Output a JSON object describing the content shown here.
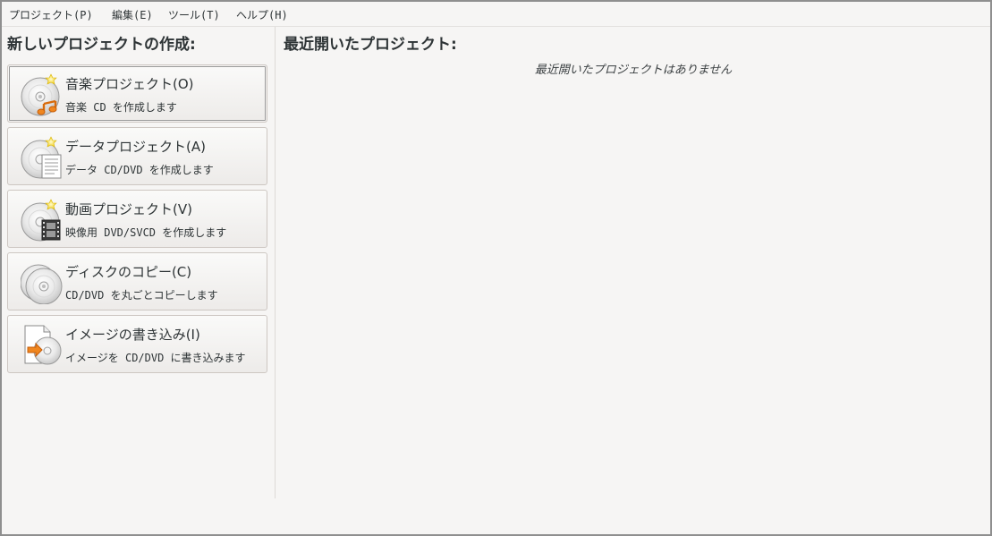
{
  "menubar": {
    "items": [
      "プロジェクト(P)",
      "編集(E)",
      "ツール(T)",
      "ヘルプ(H)"
    ]
  },
  "new_project": {
    "heading": "新しいプロジェクトの作成:",
    "buttons": [
      {
        "title": "音楽プロジェクト(O)",
        "subtitle": "音楽 CD を作成します",
        "icon": "audio-disc-icon"
      },
      {
        "title": "データプロジェクト(A)",
        "subtitle": "データ CD/DVD を作成します",
        "icon": "data-disc-icon"
      },
      {
        "title": "動画プロジェクト(V)",
        "subtitle": "映像用 DVD/SVCD を作成します",
        "icon": "video-disc-icon"
      },
      {
        "title": "ディスクのコピー(C)",
        "subtitle": "CD/DVD を丸ごとコピーします",
        "icon": "disc-copy-icon"
      },
      {
        "title": "イメージの書き込み(I)",
        "subtitle": "イメージを CD/DVD に書き込みます",
        "icon": "image-burn-icon"
      }
    ]
  },
  "recent": {
    "heading": "最近開いたプロジェクト:",
    "empty_message": "最近開いたプロジェクトはありません"
  },
  "colors": {
    "background": "#f6f5f4",
    "text": "#2e3436",
    "music_note": "#f0861e",
    "star": "#f7e04a"
  }
}
